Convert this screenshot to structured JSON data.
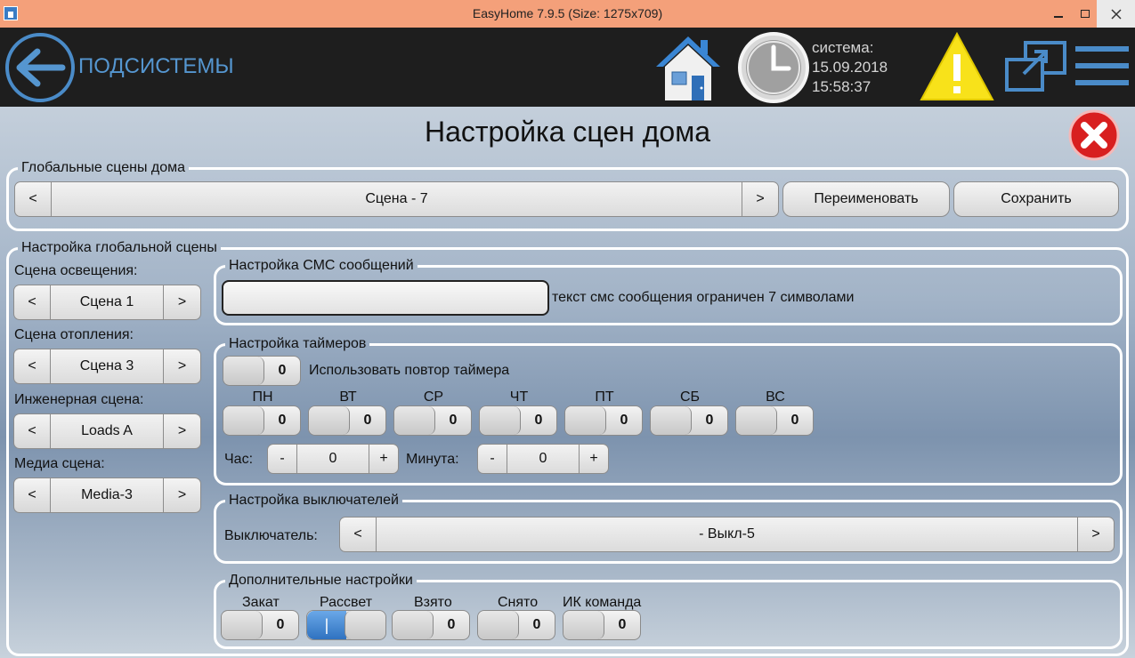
{
  "window": {
    "title": "EasyHome 7.9.5 (Size: 1275x709)"
  },
  "header": {
    "back_label": "ПОДСИСТЕМЫ",
    "system_label": "система:",
    "date": "15.09.2018",
    "time": "15:58:37",
    "icons": [
      "back-arrow-icon",
      "home-icon",
      "clock-icon",
      "warning-icon",
      "window-switch-icon",
      "menu-icon"
    ]
  },
  "page": {
    "title": "Настройка сцен дома"
  },
  "global_scenes": {
    "legend": "Глобальные сцены дома",
    "prev": "<",
    "next": ">",
    "current": "Сцена - 7",
    "rename": "Переименовать",
    "save": "Сохранить"
  },
  "scene_settings": {
    "legend": "Настройка глобальной сцены",
    "lighting": {
      "label": "Сцена освещения:",
      "prev": "<",
      "value": "Сцена 1",
      "next": ">"
    },
    "heating": {
      "label": "Сцена отопления:",
      "prev": "<",
      "value": "Сцена 3",
      "next": ">"
    },
    "engineering": {
      "label": "Инженерная сцена:",
      "prev": "<",
      "value": "Loads A",
      "next": ">"
    },
    "media": {
      "label": "Медиа сцена:",
      "prev": "<",
      "value": "Media-3",
      "next": ">"
    }
  },
  "sms": {
    "legend": "Настройка СМС сообщений",
    "value": "",
    "hint": "текст смс сообщения ограничен 7 символами"
  },
  "timers": {
    "legend": "Настройка таймеров",
    "repeat": {
      "value": "0",
      "label": "Использовать повтор таймера"
    },
    "days": [
      {
        "label": "ПН",
        "value": "0"
      },
      {
        "label": "ВТ",
        "value": "0"
      },
      {
        "label": "СР",
        "value": "0"
      },
      {
        "label": "ЧТ",
        "value": "0"
      },
      {
        "label": "ПТ",
        "value": "0"
      },
      {
        "label": "СБ",
        "value": "0"
      },
      {
        "label": "ВС",
        "value": "0"
      }
    ],
    "hour": {
      "label": "Час:",
      "minus": "-",
      "value": "0",
      "plus": "+"
    },
    "minute": {
      "label": "Минута:",
      "minus": "-",
      "value": "0",
      "plus": "+"
    }
  },
  "switches": {
    "legend": "Настройка выключателей",
    "label": "Выключатель:",
    "prev": "<",
    "value": "- Выкл-5",
    "next": ">"
  },
  "extra": {
    "legend": "Дополнительные настройки",
    "items": [
      {
        "label": "Закат",
        "value": "0",
        "on": false
      },
      {
        "label": "Рассвет",
        "value": "|",
        "on": true
      },
      {
        "label": "Взято",
        "value": "0",
        "on": false
      },
      {
        "label": "Снято",
        "value": "0",
        "on": false
      },
      {
        "label": "ИК команда",
        "value": "0",
        "on": false
      }
    ]
  },
  "colors": {
    "header_bg": "#1e1e1e",
    "titlebar_bg": "#f4a07a",
    "accent_blue": "#4a8bc8",
    "toggle_on": "#2f72c0"
  }
}
